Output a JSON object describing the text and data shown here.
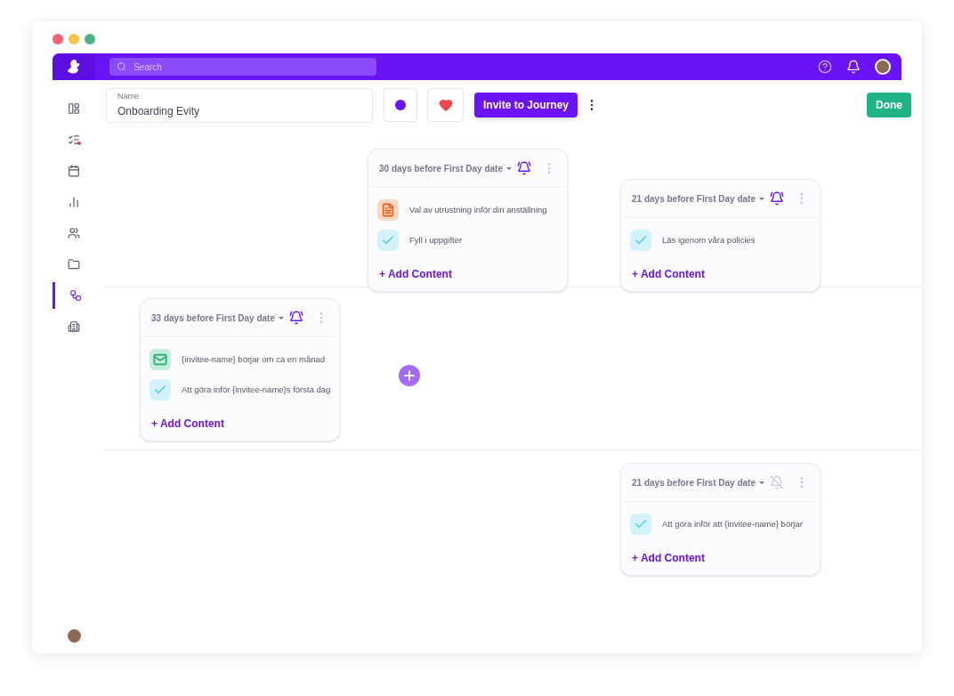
{
  "top_bar": {
    "search": {
      "placeholder": "Search"
    }
  },
  "sidebar": {
    "items": [
      {
        "selected": false,
        "alert": false
      },
      {
        "selected": false,
        "alert": true
      },
      {
        "selected": false,
        "alert": false
      },
      {
        "selected": false,
        "alert": false
      },
      {
        "selected": false,
        "alert": false
      },
      {
        "selected": false,
        "alert": false
      },
      {
        "selected": true,
        "alert": false
      },
      {
        "selected": false,
        "alert": false
      }
    ]
  },
  "toolbar": {
    "name_field": {
      "label": "Name",
      "value": "Onboarding Evity"
    },
    "invite_button": "Invite to Journey",
    "done_button": "Done"
  },
  "lanes": [
    {
      "cards": [
        {
          "timing": "30 days before First Day date",
          "reminder": true,
          "items": [
            {
              "kind": "document",
              "title": "Val av utrustning inför din anställning"
            },
            {
              "kind": "task",
              "title": "Fyll i uppgifter"
            }
          ],
          "add_label": "+ Add Content"
        },
        {
          "timing": "21 days before First Day date",
          "reminder": true,
          "items": [
            {
              "kind": "task",
              "title": "Läs igenom våra policies"
            }
          ],
          "add_label": "+ Add Content"
        }
      ]
    },
    {
      "add_button": true,
      "cards": [
        {
          "timing": "33 days before First Day date",
          "reminder": true,
          "items": [
            {
              "kind": "email",
              "title": "{invitee-name} börjar om ca en månad"
            },
            {
              "kind": "task",
              "title": "Att göra inför {invitee-name}s första dag"
            }
          ],
          "add_label": "+ Add Content"
        }
      ]
    },
    {
      "cards": [
        {
          "timing": "21 days before First Day date",
          "reminder": false,
          "items": [
            {
              "kind": "task",
              "title": "Att göra inför att {invitee-name} börjar"
            }
          ],
          "add_label": "+ Add Content"
        }
      ]
    }
  ]
}
